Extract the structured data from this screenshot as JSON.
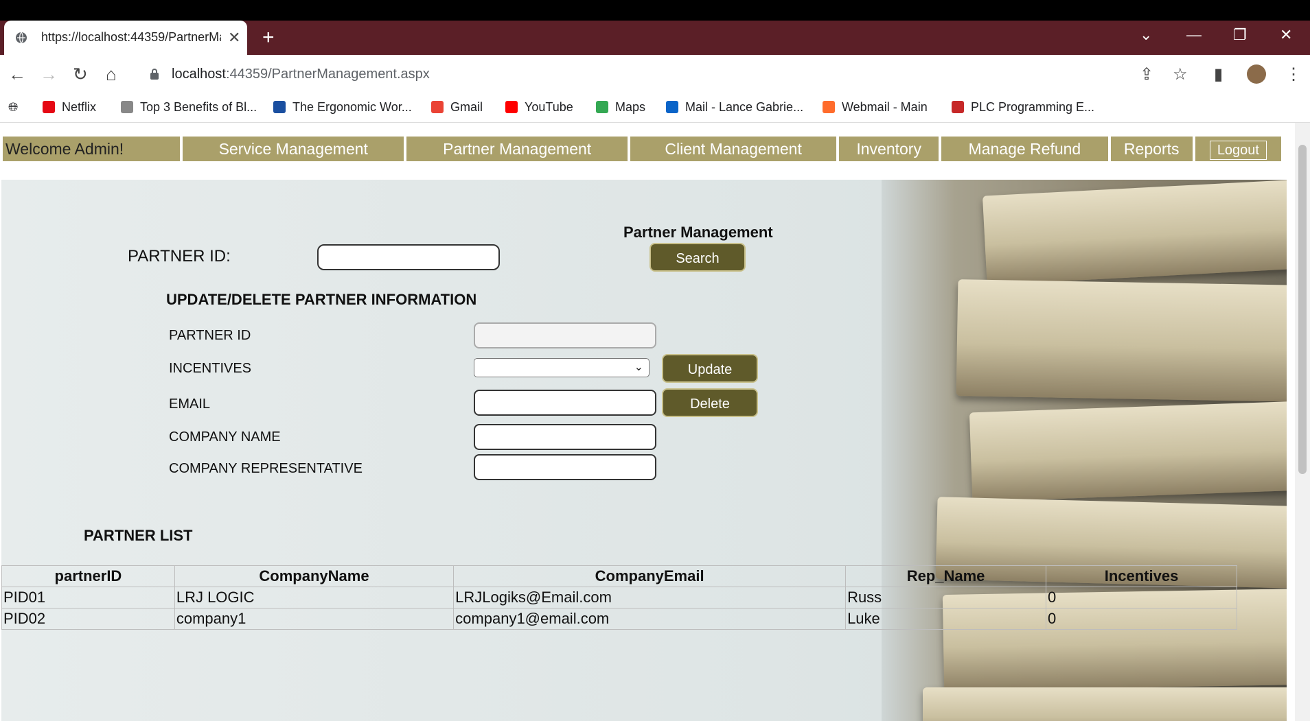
{
  "browser": {
    "tab_title": "https://localhost:44359/PartnerManagement.aspx",
    "url_host": "localhost",
    "url_rest": ":44359/PartnerManagement.aspx",
    "bookmarks": [
      {
        "label": "Netflix",
        "color": "#e50914"
      },
      {
        "label": "Top 3 Benefits of Bl...",
        "color": "#888888"
      },
      {
        "label": "The Ergonomic Wor...",
        "color": "#1a4fa0"
      },
      {
        "label": "Gmail",
        "color": "#ea4335"
      },
      {
        "label": "YouTube",
        "color": "#ff0000"
      },
      {
        "label": "Maps",
        "color": "#34a853"
      },
      {
        "label": "Mail - Lance Gabrie...",
        "color": "#0a64c8"
      },
      {
        "label": "Webmail - Main",
        "color": "#ff6c2c"
      },
      {
        "label": "PLC Programming E...",
        "color": "#c62828"
      }
    ]
  },
  "nav": {
    "welcome": "Welcome Admin!",
    "items": [
      "Service Management",
      "Partner Management",
      "Client Management",
      "Inventory",
      "Manage Refund",
      "Reports"
    ],
    "logout": "Logout"
  },
  "page": {
    "header": "Partner Management",
    "search_label": "PARTNER ID:",
    "search_button": "Search",
    "update_section": "UPDATE/DELETE PARTNER INFORMATION",
    "fields": {
      "partner_id": "PARTNER ID",
      "incentives": "INCENTIVES",
      "email": "EMAIL",
      "company_name": "COMPANY NAME",
      "company_rep": "COMPANY REPRESENTATIVE"
    },
    "update_button": "Update",
    "delete_button": "Delete",
    "list_title": "PARTNER LIST"
  },
  "table": {
    "headers": [
      "partnerID",
      "CompanyName",
      "CompanyEmail",
      "Rep_Name",
      "Incentives"
    ],
    "rows": [
      [
        "PID01",
        "LRJ LOGIC",
        "LRJLogiks@Email.com",
        "Russ",
        "0"
      ],
      [
        "PID02",
        "company1",
        "company1@email.com",
        "Luke",
        "0"
      ]
    ]
  },
  "colors": {
    "nav_bg": "#aaa06a",
    "button_bg": "#5f5a2a",
    "titlebar": "#5b1f27"
  }
}
